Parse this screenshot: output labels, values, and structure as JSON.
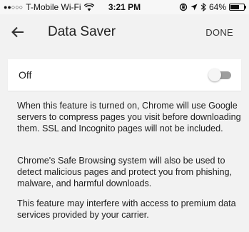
{
  "status_bar": {
    "signal_dots": "●●○○○",
    "carrier": "T-Mobile Wi-Fi",
    "time": "3:21 PM",
    "battery_percent": "64%",
    "battery_level": 0.64,
    "icons": [
      "wifi-icon",
      "lock-rotation-icon",
      "location-arrow-icon",
      "bluetooth-icon",
      "battery-icon"
    ]
  },
  "toolbar": {
    "title": "Data Saver",
    "done_label": "DONE"
  },
  "setting": {
    "label": "Off",
    "enabled": false
  },
  "description": [
    "When this feature is turned on, Chrome will use Google servers to compress pages you visit before downloading them. SSL and Incognito pages will not be included.",
    "Chrome's Safe Browsing system will also be used to detect malicious pages and protect you from phishing, malware, and harmful downloads.",
    "This feature may interfere with access to premium data services provided by your carrier."
  ],
  "colors": {
    "background": "#f2f2f2",
    "card": "#ffffff",
    "toggle_track_off": "#9e9e9e",
    "toggle_thumb_off": "#f5f5f5"
  }
}
